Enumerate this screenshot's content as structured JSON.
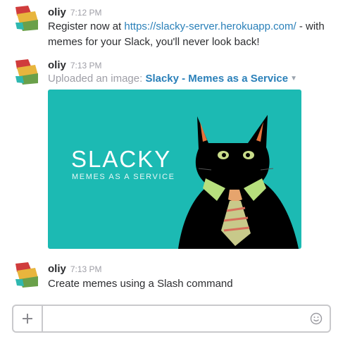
{
  "messages": [
    {
      "author": "oliy",
      "time": "7:12 PM",
      "text_before": "Register now at ",
      "link": "https://slacky-server.herokuapp.com/",
      "text_after": " - with memes for your Slack, you'll never look back!"
    },
    {
      "author": "oliy",
      "time": "7:13 PM",
      "upload_prefix": "Uploaded an image: ",
      "file_title": "Slacky - Memes as a Service",
      "image": {
        "title": "SLACKY",
        "subtitle": "MEMES AS A SERVICE"
      }
    },
    {
      "author": "oliy",
      "time": "7:13 PM",
      "text": "Create memes using a Slash command"
    }
  ],
  "composer": {
    "placeholder": "",
    "value": ""
  },
  "colors": {
    "link": "#2a80b9",
    "image_bg": "#1cbab3",
    "avatar": [
      "#d03c3c",
      "#e8b53d",
      "#6aa04a",
      "#2fb8b0"
    ]
  },
  "icons": {
    "attach": "plus-icon",
    "emoji": "smiley-icon",
    "file_menu": "caret-down-icon"
  }
}
